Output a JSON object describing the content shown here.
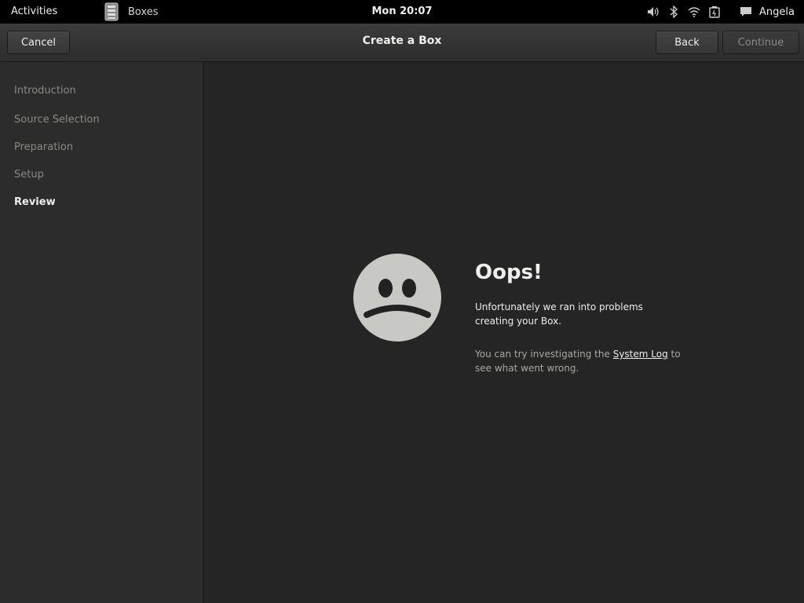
{
  "topbar": {
    "activities": "Activities",
    "app_name": "Boxes",
    "clock": "Mon 20:07",
    "user": "Angela"
  },
  "header": {
    "cancel": "Cancel",
    "title": "Create a Box",
    "back": "Back",
    "continue": "Continue"
  },
  "sidebar": {
    "steps": [
      {
        "label": "Introduction"
      },
      {
        "label": "Source Selection"
      },
      {
        "label": "Preparation"
      },
      {
        "label": "Setup"
      },
      {
        "label": "Review"
      }
    ],
    "active_step": "Review"
  },
  "main": {
    "title": "Oops!",
    "message": "Unfortunately we ran into problems creating your Box.",
    "hint_before": "You can try investigating the ",
    "hint_link": "System Log",
    "hint_after": " to see what went wrong."
  },
  "colors": {
    "background": "#252525",
    "sidebar": "#2c2c2c",
    "face": "#c8c8c4",
    "text": "#eeeeec",
    "dim_text": "#888a85"
  },
  "icons": [
    "boxes-app-icon",
    "volume-icon",
    "bluetooth-icon",
    "wifi-icon",
    "battery-icon",
    "chat-icon",
    "sad-face-icon"
  ]
}
